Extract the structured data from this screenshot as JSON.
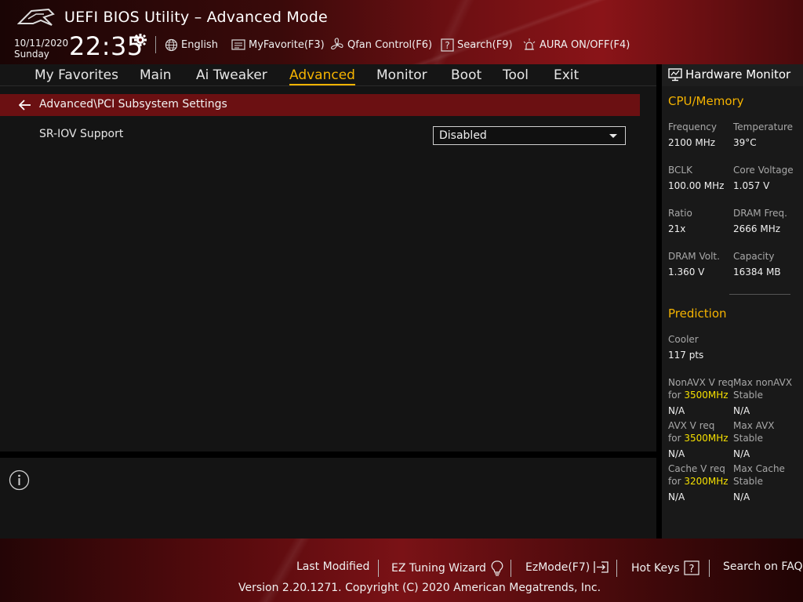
{
  "header": {
    "app_title": "UEFI BIOS Utility – Advanced Mode",
    "date": "10/11/2020",
    "day": "Sunday",
    "time": "22:35",
    "items": {
      "language": "English",
      "my_favorite": "MyFavorite(F3)",
      "qfan": "Qfan Control(F6)",
      "search": "Search(F9)",
      "aura": "AURA ON/OFF(F4)"
    }
  },
  "nav": {
    "tabs": [
      "My Favorites",
      "Main",
      "Ai Tweaker",
      "Advanced",
      "Monitor",
      "Boot",
      "Tool",
      "Exit"
    ],
    "active": "Advanced"
  },
  "main": {
    "breadcrumb": "Advanced\\PCI Subsystem Settings",
    "settings": [
      {
        "label": "SR-IOV Support",
        "value": "Disabled"
      }
    ]
  },
  "hardware_monitor": {
    "title": "Hardware Monitor",
    "cpu_memory": {
      "title": "CPU/Memory",
      "frequency_label": "Frequency",
      "frequency": "2100 MHz",
      "temperature_label": "Temperature",
      "temperature": "39°C",
      "bclk_label": "BCLK",
      "bclk": "100.00 MHz",
      "core_voltage_label": "Core Voltage",
      "core_voltage": "1.057 V",
      "ratio_label": "Ratio",
      "ratio": "21x",
      "dram_freq_label": "DRAM Freq.",
      "dram_freq": "2666 MHz",
      "dram_volt_label": "DRAM Volt.",
      "dram_volt": "1.360 V",
      "capacity_label": "Capacity",
      "capacity": "16384 MB"
    },
    "prediction": {
      "title": "Prediction",
      "cooler_label": "Cooler",
      "cooler": "117 pts",
      "nonavx_label": "NonAVX V req",
      "nonavx_for": "for",
      "nonavx_freq": "3500MHz",
      "nonavx_value": "N/A",
      "max_nonavx_label1": "Max nonAVX",
      "max_nonavx_label2": "Stable",
      "max_nonavx_value": "N/A",
      "avx_label": "AVX V req",
      "avx_for": "for",
      "avx_freq": "3500MHz",
      "avx_value": "N/A",
      "max_avx_label1": "Max AVX",
      "max_avx_label2": "Stable",
      "max_avx_value": "N/A",
      "cache_label": "Cache V req",
      "cache_for": "for",
      "cache_freq": "3200MHz",
      "cache_value": "N/A",
      "max_cache_label1": "Max Cache",
      "max_cache_label2": "Stable",
      "max_cache_value": "N/A"
    }
  },
  "footer": {
    "last_modified": "Last Modified",
    "ez_tuning": "EZ Tuning Wizard",
    "ez_mode": "EzMode(F7)",
    "hot_keys": "Hot Keys",
    "search_faq": "Search on FAQ",
    "copyright": "Version 2.20.1271. Copyright (C) 2020 American Megatrends, Inc."
  },
  "colors": {
    "accent": "#f5b300",
    "highlight": "#f5e000",
    "breadcrumb_bg": "#6b1012"
  }
}
